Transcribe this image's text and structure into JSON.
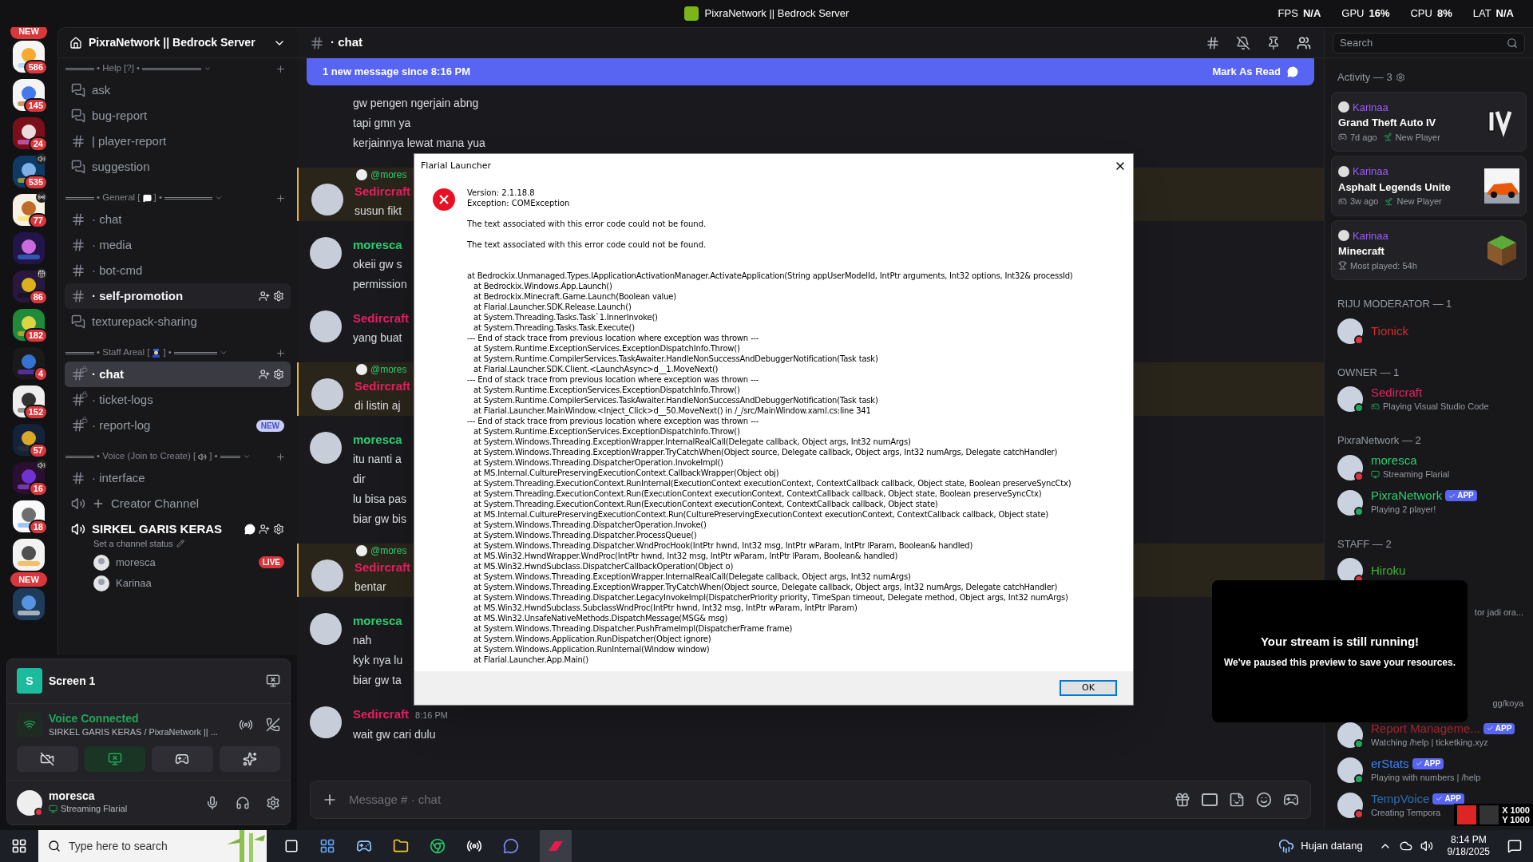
{
  "titlebar": {
    "title": "PixraNetwork || Bedrock Server",
    "stats": [
      {
        "label": "FPS",
        "value": "N/A"
      },
      {
        "label": "GPU",
        "value": "16%"
      },
      {
        "label": "CPU",
        "value": "8%"
      },
      {
        "label": "LAT",
        "value": "N/A"
      }
    ]
  },
  "servers": [
    {
      "kind": "pill",
      "label": "NEW"
    },
    {
      "kind": "server",
      "badge": "586"
    },
    {
      "kind": "server",
      "badge": "145"
    },
    {
      "kind": "server",
      "badge": "24"
    },
    {
      "kind": "server",
      "badge": "535",
      "indicator": {
        "kind": "voice"
      }
    },
    {
      "kind": "server",
      "badge": "77",
      "indicator": {
        "kind": "stage"
      }
    },
    {
      "kind": "server"
    },
    {
      "kind": "server",
      "badge": "86",
      "indicator": {
        "kind": "event"
      }
    },
    {
      "kind": "server",
      "badge": "182"
    },
    {
      "kind": "server",
      "badge": "4"
    },
    {
      "kind": "server",
      "badge": "152"
    },
    {
      "kind": "server",
      "badge": "57"
    },
    {
      "kind": "server",
      "badge": "16",
      "indicator": {
        "kind": "voice"
      }
    },
    {
      "kind": "server",
      "badge": "18"
    },
    {
      "kind": "server"
    },
    {
      "kind": "pill",
      "label": "NEW"
    },
    {
      "kind": "server"
    }
  ],
  "server_header": {
    "name": "PixraNetwork || Bedrock Server"
  },
  "categories": [
    {
      "prefix": "• Help [?] •",
      "channels": [
        {
          "kind": "forum",
          "name": "ask",
          "selected": false
        },
        {
          "kind": "forum",
          "name": "bug-report",
          "selected": false
        },
        {
          "kind": "text",
          "name": "| player-report",
          "selected": false
        },
        {
          "kind": "forum",
          "name": "suggestion",
          "selected": false
        }
      ]
    },
    {
      "prefix": "• General [",
      "emoji": {
        "kind": "speech"
      },
      "suffix": "] •",
      "channels": [
        {
          "kind": "text",
          "name": "· chat",
          "selected": false
        },
        {
          "kind": "text",
          "name": "· media",
          "selected": false
        },
        {
          "kind": "text",
          "name": "· bot-cmd",
          "selected": false
        },
        {
          "kind": "text",
          "name": "· self-promotion",
          "selected": false,
          "hovered": true
        },
        {
          "kind": "forum",
          "name": "texturepack-sharing",
          "selected": false
        }
      ]
    },
    {
      "prefix": "• Staff Areal [",
      "emoji": {
        "kind": "officer"
      },
      "suffix": "] •",
      "channels": [
        {
          "kind": "locked",
          "name": "· chat",
          "selected": true
        },
        {
          "kind": "locked",
          "name": "· ticket-logs",
          "selected": false
        },
        {
          "kind": "locked",
          "name": "· report-log",
          "selected": false,
          "badge": "NEW"
        }
      ]
    },
    {
      "prefix": "• Voice (Join to Create) [",
      "emoji": {
        "kind": "speaker"
      },
      "suffix": "] •",
      "channels": [
        {
          "kind": "text",
          "name": "· interface",
          "selected": false
        },
        {
          "kind": "creator",
          "name": "Creator Channel",
          "selected": false
        },
        {
          "kind": "voice",
          "name": "SIRKEL GARIS KERAS",
          "selected": false,
          "status": "Set a channel status",
          "members": [
            {
              "name": "moresca",
              "live": "LIVE"
            },
            {
              "name": "Karinaa"
            }
          ]
        }
      ]
    }
  ],
  "voice_panel": {
    "stream_title": "Screen 1",
    "stream_initial": "S",
    "connection": "Voice Connected",
    "location": "SIRKEL GARIS KERAS / PixraNetwork || ...",
    "user": {
      "name": "moresca",
      "status": "Streaming Flarial"
    }
  },
  "chat": {
    "channel": "· chat",
    "banner": {
      "text": "1 new message since 8:16 PM",
      "action": "Mark As Read"
    },
    "search": {
      "placeholder": "Search"
    },
    "messages": [
      {
        "lines": [
          "gw pengen ngerjain abng",
          "tapi gmn ya",
          "kerjainnya lewat mana yua"
        ]
      },
      {
        "reply": "@mores",
        "author": "Sedircraft",
        "color": "#e91e63",
        "lines": [
          "susun fikt"
        ]
      },
      {
        "author": "moresca",
        "color": "#2ecc71",
        "lines": [
          "okeii gw s",
          "permission"
        ]
      },
      {
        "author": "Sedircraft",
        "color": "#e91e63",
        "lines": [
          "yang buat"
        ]
      },
      {
        "reply": "@mores",
        "author": "Sedircraft",
        "color": "#e91e63",
        "lines": [
          "di listin aj"
        ]
      },
      {
        "author": "moresca",
        "color": "#2ecc71",
        "lines": [
          "itu nanti a",
          "dir",
          "lu bisa pas",
          "biar gw bis"
        ]
      },
      {
        "reply": "@mores",
        "author": "Sedircraft",
        "color": "#e91e63",
        "lines": [
          "bentar"
        ]
      },
      {
        "author": "moresca",
        "color": "#2ecc71",
        "lines": [
          "nah",
          "kyk nya lu",
          "biar gw ta"
        ]
      },
      {
        "author": "Sedircraft",
        "color": "#e91e63",
        "time": "8:16 PM",
        "lines": [
          "wait gw cari dulu"
        ]
      }
    ],
    "input": {
      "placeholder": "Message # · chat"
    }
  },
  "dialog": {
    "title": "Flarial Launcher",
    "header": [
      "Version: 2.1.18.8",
      "Exception: COMException"
    ],
    "messages": [
      "The text associated with this error code could not be found.",
      "The text associated with this error code could not be found."
    ],
    "trace": [
      {
        "kind": "head",
        "text": "at Bedrockix.Unmanaged.Types.IApplicationActivationManager.ActivateApplication(String appUserModelId, IntPtr arguments, Int32 options, Int32& processId)"
      },
      {
        "kind": "frame",
        "text": "at Bedrockix.Windows.App.Launch()"
      },
      {
        "kind": "frame",
        "text": "at Bedrockix.Minecraft.Game.Launch(Boolean value)"
      },
      {
        "kind": "frame",
        "text": "at Flarial.Launcher.SDK.Release.Launch()"
      },
      {
        "kind": "frame",
        "text": "at System.Threading.Tasks.Task`1.InnerInvoke()"
      },
      {
        "kind": "frame",
        "text": "at System.Threading.Tasks.Task.Execute()"
      },
      {
        "kind": "head",
        "text": "--- End of stack trace from previous location where exception was thrown ---"
      },
      {
        "kind": "frame",
        "text": "at System.Runtime.ExceptionServices.ExceptionDispatchInfo.Throw()"
      },
      {
        "kind": "frame",
        "text": "at System.Runtime.CompilerServices.TaskAwaiter.HandleNonSuccessAndDebuggerNotification(Task task)"
      },
      {
        "kind": "frame",
        "text": "at Flarial.Launcher.SDK.Client.<LaunchAsync>d__1.MoveNext()"
      },
      {
        "kind": "head",
        "text": "--- End of stack trace from previous location where exception was thrown ---"
      },
      {
        "kind": "frame",
        "text": "at System.Runtime.ExceptionServices.ExceptionDispatchInfo.Throw()"
      },
      {
        "kind": "frame",
        "text": "at System.Runtime.CompilerServices.TaskAwaiter.HandleNonSuccessAndDebuggerNotification(Task task)"
      },
      {
        "kind": "frame",
        "text": "at Flarial.Launcher.MainWindow.<Inject_Click>d__50.MoveNext() in /_/src/MainWindow.xaml.cs:line 341"
      },
      {
        "kind": "head",
        "text": "--- End of stack trace from previous location where exception was thrown ---"
      },
      {
        "kind": "frame",
        "text": "at System.Runtime.ExceptionServices.ExceptionDispatchInfo.Throw()"
      },
      {
        "kind": "frame",
        "text": "at System.Windows.Threading.ExceptionWrapper.InternalRealCall(Delegate callback, Object args, Int32 numArgs)"
      },
      {
        "kind": "frame",
        "text": "at System.Windows.Threading.ExceptionWrapper.TryCatchWhen(Object source, Delegate callback, Object args, Int32 numArgs, Delegate catchHandler)"
      },
      {
        "kind": "frame",
        "text": "at System.Windows.Threading.DispatcherOperation.InvokeImpl()"
      },
      {
        "kind": "frame",
        "text": "at MS.Internal.CulturePreservingExecutionContext.CallbackWrapper(Object obj)"
      },
      {
        "kind": "frame",
        "text": "at System.Threading.ExecutionContext.RunInternal(ExecutionContext executionContext, ContextCallback callback, Object state, Boolean preserveSyncCtx)"
      },
      {
        "kind": "frame",
        "text": "at System.Threading.ExecutionContext.Run(ExecutionContext executionContext, ContextCallback callback, Object state, Boolean preserveSyncCtx)"
      },
      {
        "kind": "frame",
        "text": "at System.Threading.ExecutionContext.Run(ExecutionContext executionContext, ContextCallback callback, Object state)"
      },
      {
        "kind": "frame",
        "text": "at MS.Internal.CulturePreservingExecutionContext.Run(CulturePreservingExecutionContext executionContext, ContextCallback callback, Object state)"
      },
      {
        "kind": "frame",
        "text": "at System.Windows.Threading.DispatcherOperation.Invoke()"
      },
      {
        "kind": "frame",
        "text": "at System.Windows.Threading.Dispatcher.ProcessQueue()"
      },
      {
        "kind": "frame",
        "text": "at System.Windows.Threading.Dispatcher.WndProcHook(IntPtr hwnd, Int32 msg, IntPtr wParam, IntPtr lParam, Boolean& handled)"
      },
      {
        "kind": "frame",
        "text": "at MS.Win32.HwndWrapper.WndProc(IntPtr hwnd, Int32 msg, IntPtr wParam, IntPtr lParam, Boolean& handled)"
      },
      {
        "kind": "frame",
        "text": "at MS.Win32.HwndSubclass.DispatcherCallbackOperation(Object o)"
      },
      {
        "kind": "frame",
        "text": "at System.Windows.Threading.ExceptionWrapper.InternalRealCall(Delegate callback, Object args, Int32 numArgs)"
      },
      {
        "kind": "frame",
        "text": "at System.Windows.Threading.ExceptionWrapper.TryCatchWhen(Object source, Delegate callback, Object args, Int32 numArgs, Delegate catchHandler)"
      },
      {
        "kind": "frame",
        "text": "at System.Windows.Threading.Dispatcher.LegacyInvokeImpl(DispatcherPriority priority, TimeSpan timeout, Delegate method, Object args, Int32 numArgs)"
      },
      {
        "kind": "frame",
        "text": "at MS.Win32.HwndSubclass.SubclassWndProc(IntPtr hwnd, Int32 msg, IntPtr wParam, IntPtr lParam)"
      },
      {
        "kind": "frame",
        "text": "at MS.Win32.UnsafeNativeMethods.DispatchMessage(MSG& msg)"
      },
      {
        "kind": "frame",
        "text": "at System.Windows.Threading.Dispatcher.PushFrameImpl(DispatcherFrame frame)"
      },
      {
        "kind": "frame",
        "text": "at System.Windows.Application.RunDispatcher(Object ignore)"
      },
      {
        "kind": "frame",
        "text": "at System.Windows.Application.RunInternal(Window window)"
      },
      {
        "kind": "frame",
        "text": "at Flarial.Launcher.App.Main()"
      }
    ],
    "button": "OK"
  },
  "members": {
    "activity": {
      "title": "Activity — 3",
      "items": [
        {
          "user": "Karinaa",
          "game": "Grand Theft Auto IV",
          "meta": "7d ago",
          "tag": "New Player",
          "art": {
            "kind": "roman"
          }
        },
        {
          "user": "Karinaa",
          "game": "Asphalt Legends Unite",
          "meta": "3w ago",
          "tag": "New Player",
          "art": {
            "kind": "car"
          }
        },
        {
          "user": "Karinaa",
          "game": "Minecraft",
          "meta": "Most played: 54h",
          "art": {
            "kind": "block"
          }
        }
      ]
    },
    "groups": [
      {
        "title": "RIJU MODERATOR — 1",
        "members": [
          {
            "name": "Tionick",
            "color": "#d92b2b",
            "presence": {
              "kind": "dnd"
            }
          }
        ]
      },
      {
        "title": "OWNER — 1",
        "members": [
          {
            "name": "Sedircraft",
            "color": "#e0245e",
            "presence": {
              "kind": "online"
            },
            "activity": "Playing Visual Studio Code",
            "activity_icon": {
              "kind": "game"
            }
          }
        ]
      },
      {
        "title": "PixraNetwork — 2",
        "members": [
          {
            "name": "moresca",
            "color": "#2ecc71",
            "presence": {
              "kind": "dnd"
            },
            "activity": "Streaming Flarial",
            "activity_icon": {
              "kind": "stream"
            }
          },
          {
            "name": "PixraNetwork",
            "color": "#2ecc71",
            "presence": {
              "kind": "online"
            },
            "app": "APP",
            "activity": "Playing 2 player!"
          }
        ]
      },
      {
        "title": "STAFF — 2",
        "members": [
          {
            "name": "Hiroku",
            "color": "#3fb52b",
            "presence": {
              "kind": "dnd"
            }
          }
        ]
      }
    ],
    "fragments": [
      "tor jadi ora...",
      "gg/koya"
    ],
    "bots": [
      {
        "name": "Report Manageme...",
        "color": "#a3232a",
        "presence": {
          "kind": "online"
        },
        "app": "APP",
        "activity": "Watching /help | ticketking.xyz"
      },
      {
        "name": "erStats",
        "color": "#3b82f6",
        "presence": {
          "kind": "online"
        },
        "app": "APP",
        "activity": "Playing with numbers | /help"
      },
      {
        "name": "TempVoice",
        "color": "#2a6fb0",
        "presence": {
          "kind": "dnd"
        },
        "app": "APP",
        "activity": "Creating Tempora"
      }
    ]
  },
  "stream_popup": {
    "title": "Your stream is still running!",
    "text": "We've paused this preview to save your resources."
  },
  "coords": [
    "X 1000",
    "Y 1000"
  ],
  "taskbar": {
    "search": {
      "placeholder": "Type here to search"
    },
    "weather": "Hujan datang",
    "time": "8:14 PM",
    "date": "9/18/2025"
  }
}
